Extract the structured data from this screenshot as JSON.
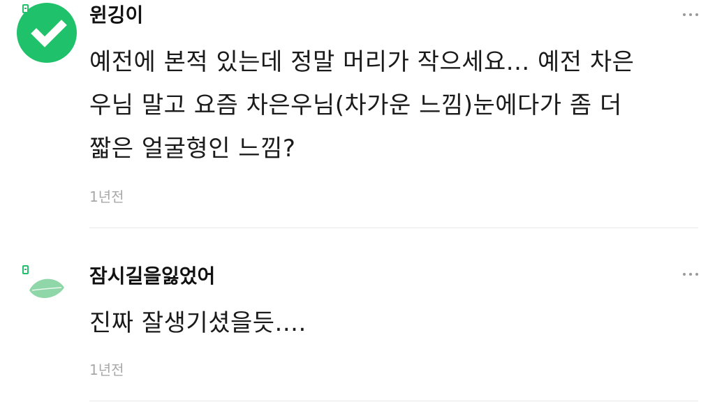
{
  "colors": {
    "accent_green": "#1fc26a",
    "leaf_green": "#8fd6a8",
    "text": "#1a1a1a",
    "muted": "#a8a8a8",
    "divider": "#e8e8e8"
  },
  "comments": [
    {
      "username": "윈깅이",
      "avatar_icon": "green-circle-check-avatar",
      "text": "예전에 본적 있는데 정말 머리가 작으세요... 예전 차은\n우님 말고 요즘 차은우님(차가운 느낌)눈에다가 좀 더\n짧은 얼굴형인 느낌?",
      "time": "1년전"
    },
    {
      "username": "잠시길을잃었어",
      "avatar_icon": "leaf-avatar",
      "text": "진짜 잘생기셨을듯....",
      "time": "1년전"
    }
  ]
}
